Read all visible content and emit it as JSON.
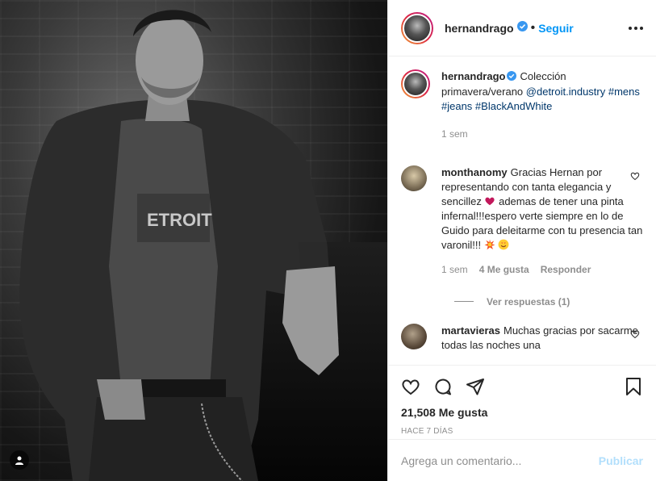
{
  "post_author": {
    "username": "hernandrago",
    "follow_label": "Seguir",
    "separator": "•"
  },
  "caption": {
    "username": "hernandrago",
    "text_prefix": "Colección primavera/verano ",
    "mention": "@detroit.industry",
    "hashtags": "#mens #jeans #BlackAndWhite",
    "time": "1 sem"
  },
  "comments": [
    {
      "username": "monthanomy",
      "text_part1": "Gracias Hernan por representando con tanta elegancia y sencillez",
      "text_part2": " ademas de tener una pinta infernal!!!espero verte siempre en lo de Guido para deleitarme con tu presencia tan varonil!!!",
      "time": "1 sem",
      "likes": "4 Me gusta",
      "reply_label": "Responder",
      "view_replies": "Ver respuestas (1)"
    },
    {
      "username": "martavieras",
      "text": "Muchas gracias por sacarme todas las noches una"
    }
  ],
  "likes_count": "21,508 Me gusta",
  "posted_time": "HACE 7 DÍAS",
  "add_comment_placeholder": "Agrega un comentario...",
  "publish_label": "Publicar",
  "icons": {
    "like": "heart-icon",
    "comment": "comment-icon",
    "share": "share-icon",
    "save": "bookmark-icon",
    "more": "more-options-icon",
    "tag": "user-tag-icon",
    "verified": "verified-badge-icon"
  },
  "colors": {
    "link": "#00376b",
    "follow": "#0095f6",
    "verified": "#3897f0",
    "publish_disabled": "#b2dffc",
    "muted": "#8e8e8e"
  }
}
